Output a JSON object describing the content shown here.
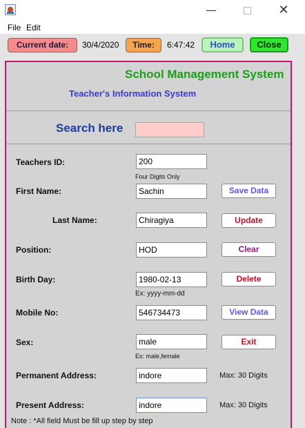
{
  "window": {
    "minimize_glyph": "—",
    "close_glyph": "✕",
    "app_icon": "java-app-icon"
  },
  "menu": {
    "file": "File",
    "edit": "Edit"
  },
  "topbar": {
    "date_label": "Current date:",
    "date_value": "30/4/2020",
    "time_label": "Time:",
    "time_value": "6:47:42",
    "home_button": "Home",
    "close_button": "Close"
  },
  "panel": {
    "title": "School Management System",
    "subtitle": "Teacher's Information System",
    "search_label": "Search here",
    "search_value": ""
  },
  "fields": {
    "teacher_id": {
      "label": "Teachers ID:",
      "value": "200",
      "hint": "Four Digits Only"
    },
    "first_name": {
      "label": "First Name:",
      "value": "Sachin"
    },
    "last_name": {
      "label": "Last Name:",
      "value": "Chiragiya"
    },
    "position": {
      "label": "Position:",
      "value": "HOD"
    },
    "birth_day": {
      "label": "Birth Day:",
      "value": "1980-02-13",
      "hint": "Ex: yyyy-mm-dd"
    },
    "mobile_no": {
      "label": "Mobile No:",
      "value": "546734473"
    },
    "sex": {
      "label": "Sex:",
      "value": "male",
      "hint": "Ex: male,female"
    },
    "permanent_address": {
      "label": "Permanent Address:",
      "value": "indore",
      "note": "Max: 30 Digits"
    },
    "present_address": {
      "label": "Present Address:",
      "value": "indore",
      "note": "Max: 30 Digits"
    }
  },
  "actions": {
    "save": "Save Data",
    "update": "Update",
    "clear": "Clear",
    "delete": "Delete",
    "view": "View Data",
    "exit": "Exit"
  },
  "footer_note": "Note : *All field Must be fill up step by step",
  "colors": {
    "title_green": "#1aa01a",
    "subtitle_blue": "#3a3acd",
    "frame_border": "#c0186e",
    "search_bg": "#ffcccc",
    "date_label_bg": "#f48a8a",
    "time_label_bg": "#f6a54c",
    "home_bg": "#baf4ba",
    "close_bg": "#2ee62e"
  }
}
